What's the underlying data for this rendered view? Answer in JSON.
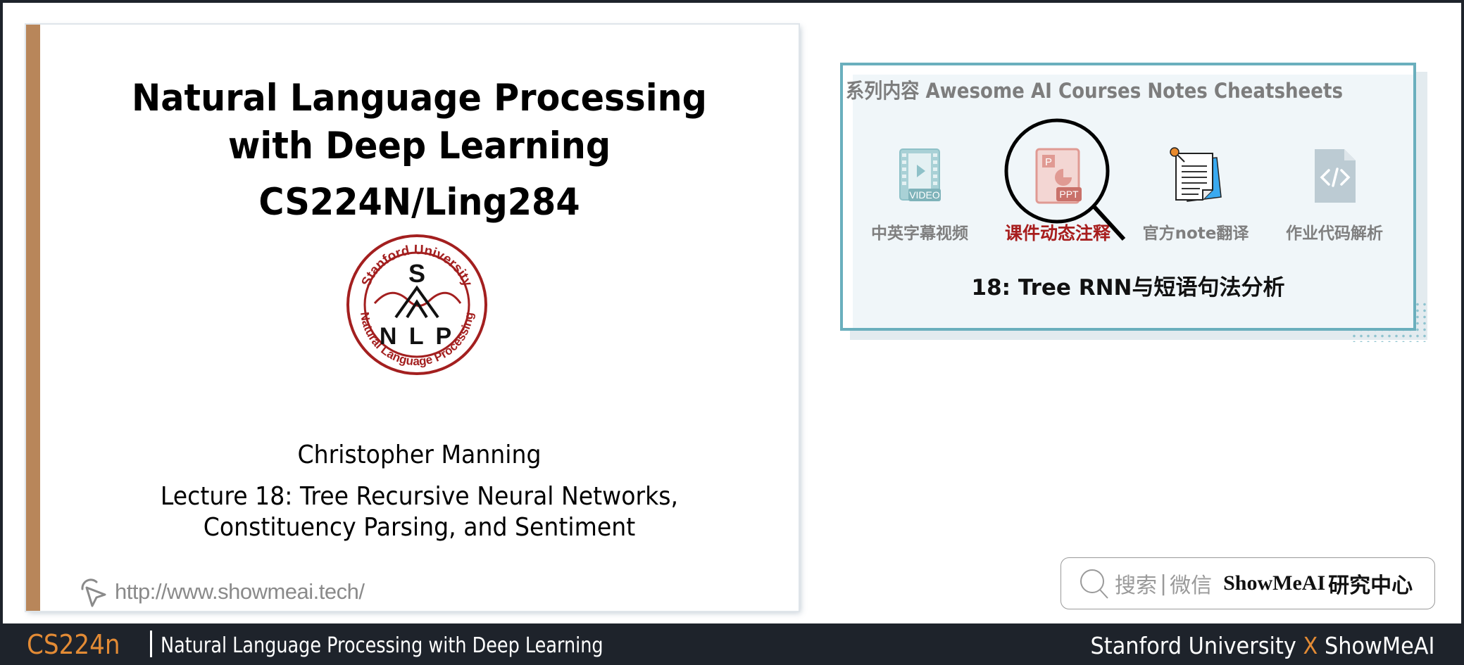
{
  "slide": {
    "title_line1": "Natural Language Processing",
    "title_line2": "with Deep Learning",
    "course_code": "CS224N/Ling284",
    "logo": {
      "top_text": "Stanford University",
      "bottom_text": "Natural Language Processing",
      "letter_top": "S",
      "letters_bottom": "N L P",
      "accent_color": "#a31f1f"
    },
    "author": "Christopher Manning",
    "lecture_line1": "Lecture 18: Tree Recursive Neural Networks,",
    "lecture_line2": "Constituency Parsing, and Sentiment",
    "url": "http://www.showmeai.tech/",
    "url_icon": "cursor-click-icon",
    "accent_bar_color": "#b8865a"
  },
  "panel": {
    "heading": "系列内容 Awesome AI Courses Notes Cheatsheets",
    "features": [
      {
        "label": "中英字幕视频",
        "icon": "video-icon",
        "active": false
      },
      {
        "label": "课件动态注释",
        "icon": "ppt-icon",
        "active": true
      },
      {
        "label": "官方note翻译",
        "icon": "note-icon",
        "active": false
      },
      {
        "label": "作业代码解析",
        "icon": "code-file-icon",
        "active": false
      }
    ],
    "lecture_title": "18: Tree RNN与短语句法分析",
    "border_color": "#6aafbd",
    "active_color": "#a71d1d"
  },
  "search": {
    "hint": "搜索",
    "separator": "|",
    "hint2": "微信",
    "brand": "ShowMeAI",
    "brand_cn": "研究中心"
  },
  "footer": {
    "course": "CS224N",
    "course_display": "CS224n",
    "title": "Natural Language Processing with Deep Learning",
    "right_part1": "Stanford University",
    "right_x": "X",
    "right_part2": "ShowMeAI",
    "accent_color": "#e38b35"
  }
}
